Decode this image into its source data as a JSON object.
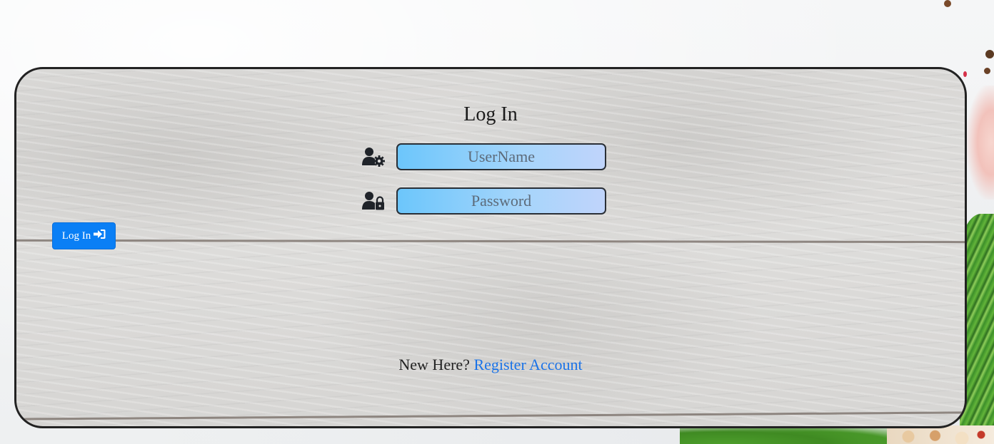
{
  "login_form": {
    "title": "Log In",
    "username": {
      "placeholder": "UserName",
      "value": "",
      "icon": "user-gear-icon"
    },
    "password": {
      "placeholder": "Password",
      "value": "",
      "icon": "user-lock-icon"
    },
    "submit": {
      "label": "Log In",
      "icon": "sign-in-icon"
    },
    "register": {
      "prompt": "New Here?",
      "link_text": "Register Account"
    }
  },
  "colors": {
    "button": "#0a7ff5",
    "link": "#1a73e8",
    "input_gradient_start": "#6cc6fb",
    "input_gradient_end": "#c0d4fb",
    "card_border": "#222222"
  }
}
